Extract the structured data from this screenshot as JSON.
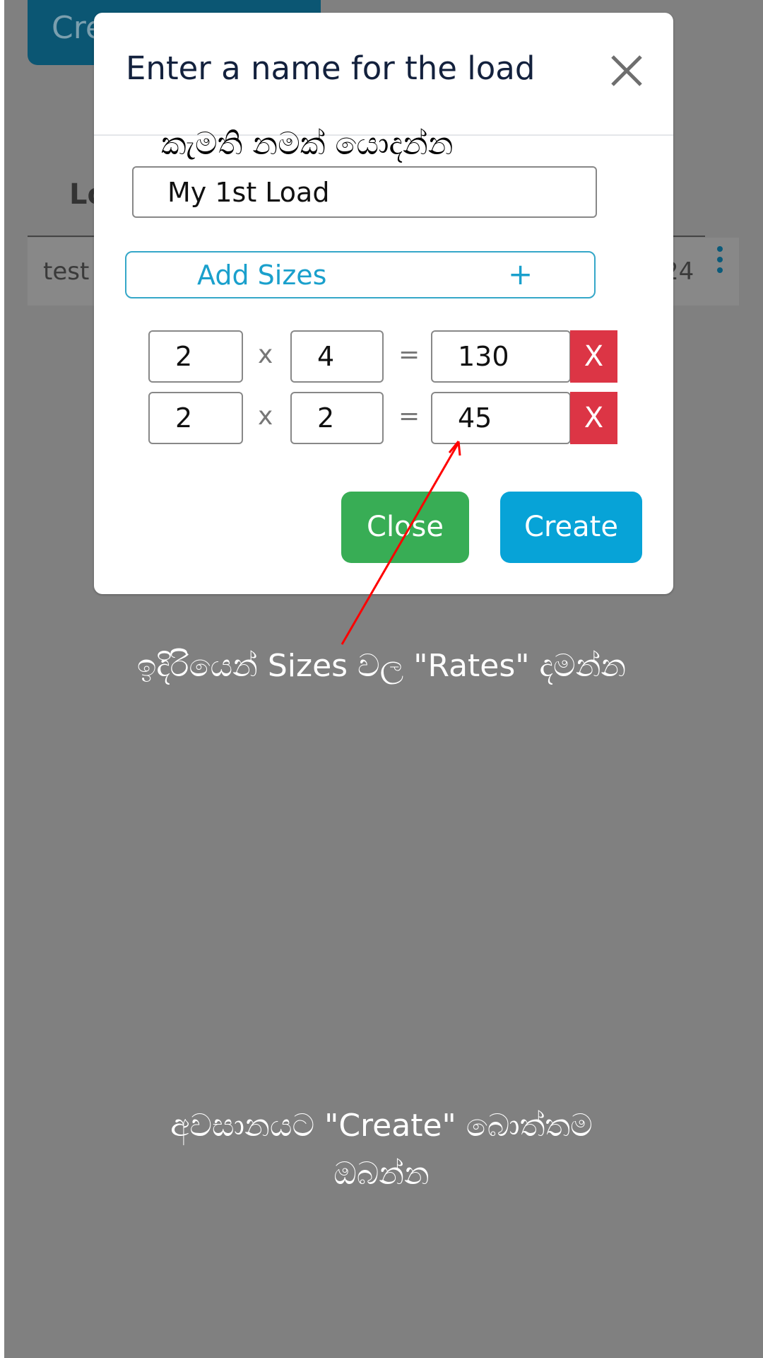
{
  "background": {
    "create_button_label": "Cre",
    "heading": "Lo",
    "row": {
      "name": "test",
      "value": "24"
    }
  },
  "modal": {
    "title": "Enter a name for the load",
    "close_icon": "close-x-icon",
    "name_label": "කැමති නමක් යොදන්න",
    "name_value": "My 1st Load",
    "add_sizes_label": "Add Sizes",
    "add_sizes_icon": "+",
    "times_symbol": "x",
    "equals_symbol": "=",
    "delete_label": "X",
    "sizes": [
      {
        "width": "2",
        "height": "4",
        "rate": "130"
      },
      {
        "width": "2",
        "height": "2",
        "rate": "45"
      }
    ],
    "close_label": "Close",
    "create_label": "Create"
  },
  "annotations": {
    "rates_hint": "ඉදිරියෙන් Sizes වල \"Rates\" දමන්න",
    "create_hint_line1": "අවසානයට \"Create\" බොත්තම",
    "create_hint_line2": "ඔබන්න",
    "arrow_color": "#ff0000"
  },
  "colors": {
    "overlay": "#808080",
    "primary": "#07a3d7",
    "success": "#38ad55",
    "danger": "#dc3545"
  }
}
